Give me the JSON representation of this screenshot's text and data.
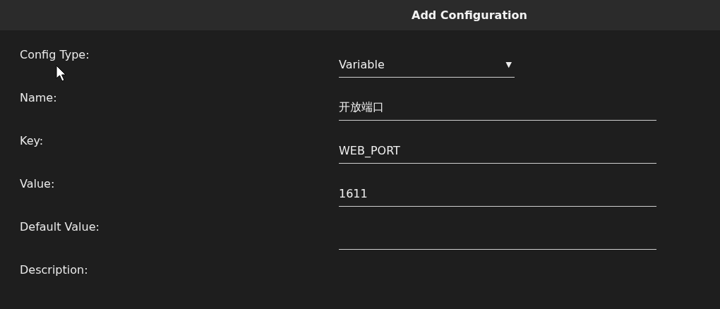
{
  "dialog": {
    "title": "Add Configuration"
  },
  "fields": [
    {
      "label": "Config Type:",
      "kind": "select",
      "value": "Variable",
      "caret": "▼"
    },
    {
      "label": "Name:",
      "kind": "text",
      "value": "开放端口"
    },
    {
      "label": "Key:",
      "kind": "text",
      "value": "WEB_PORT"
    },
    {
      "label": "Value:",
      "kind": "text",
      "value": "1611"
    },
    {
      "label": "Default Value:",
      "kind": "text"
    },
    {
      "label": "Description:",
      "kind": "none"
    }
  ]
}
